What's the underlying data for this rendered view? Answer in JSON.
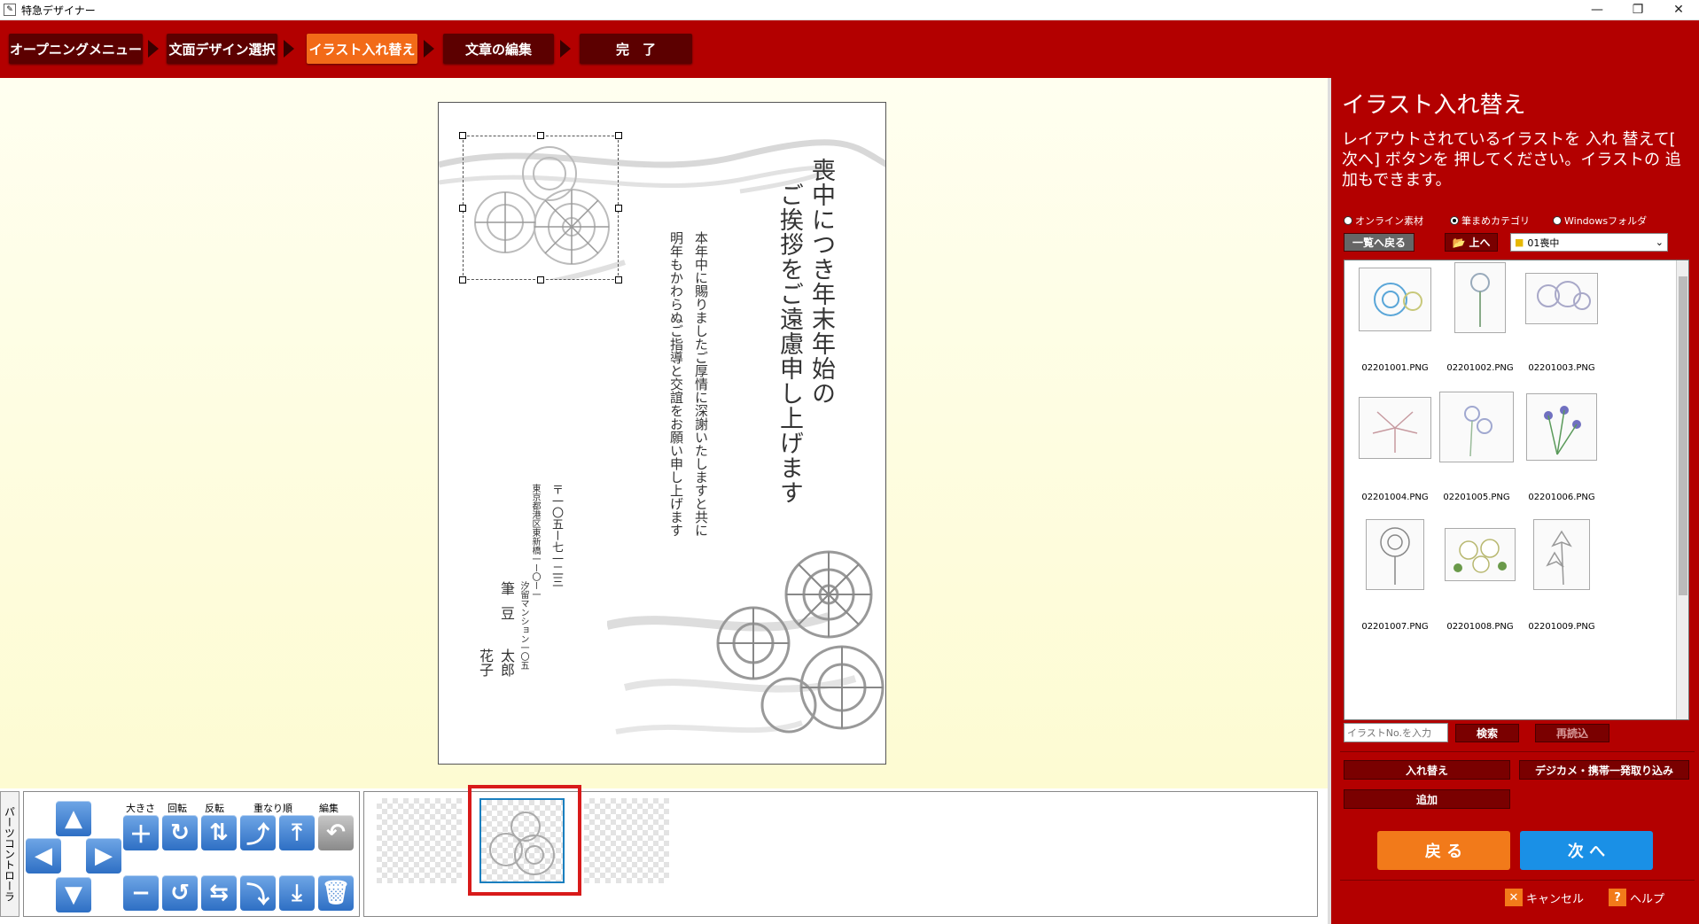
{
  "window": {
    "title": "特急デザイナー",
    "minimize": "—",
    "maximize": "❐",
    "close": "✕"
  },
  "steps": [
    {
      "label": "オープニングメニュー"
    },
    {
      "label": "文面デザイン選択"
    },
    {
      "label": "イラスト入れ替え"
    },
    {
      "label": "文章の編集"
    },
    {
      "label": "完　了"
    }
  ],
  "card": {
    "heading_line1": "喪中につき年末年始の",
    "heading_line2": "ご挨拶をご遠慮申し上げます",
    "body_line1": "本年中に賜りましたご厚情に深謝いたしますと共に",
    "body_line2": "明年もかわらぬご指導と交誼をお願い申し上げます",
    "postal": "〒一〇五ー七一二三",
    "address1": "東京都港区東新橋一ー〇ー一",
    "address2": "汐留マンション一〇五",
    "name_family": "筆",
    "name_family2": "豆",
    "name_given1": "太郎",
    "name_given2": "花子"
  },
  "controls": {
    "side_label": "パーツコントローラ",
    "size_label": "大きさ",
    "rotate_label": "回転",
    "flip_label": "反転",
    "order_label": "重なり順",
    "edit_label": "編集"
  },
  "panel": {
    "title": "イラスト入れ替え",
    "description": "レイアウトされているイラストを 入れ 替えて[ 次へ] ボタンを 押してください。イラストの 追加もできます。",
    "radio_online": "オンライン素材",
    "radio_category": "筆まめカテゴリ",
    "radio_windows": "Windowsフォルダ",
    "back_to_list": "一覧へ戻る",
    "up": "上へ",
    "folder": "01喪中",
    "gallery": [
      {
        "name": "02201001.PNG"
      },
      {
        "name": "02201002.PNG"
      },
      {
        "name": "02201003.PNG"
      },
      {
        "name": "02201004.PNG"
      },
      {
        "name": "02201005.PNG"
      },
      {
        "name": "02201006.PNG"
      },
      {
        "name": "02201007.PNG"
      },
      {
        "name": "02201008.PNG"
      },
      {
        "name": "02201009.PNG"
      }
    ],
    "search_placeholder": "イラストNo.を入力",
    "search": "検索",
    "reload": "再読込",
    "replace": "入れ替え",
    "camera_import": "デジカメ・携帯一発取り込み",
    "add": "追加",
    "back": "戻 る",
    "next": "次 へ",
    "cancel": "キャンセル",
    "help": "ヘルプ"
  },
  "colors": {
    "brand_red": "#b30000",
    "active_step": "#f26a18",
    "back_button": "#f27a1a",
    "next_button": "#1a90e6"
  }
}
